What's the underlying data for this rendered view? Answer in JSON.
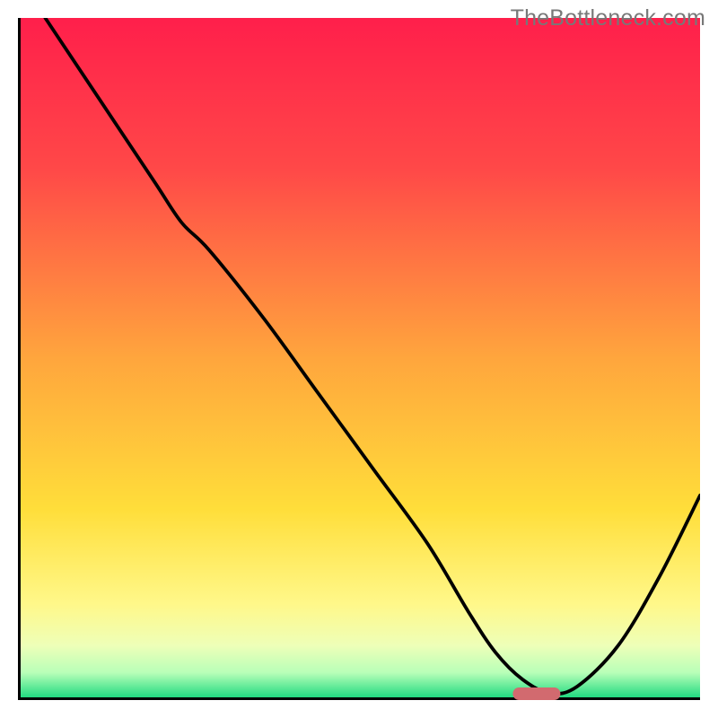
{
  "watermark": "TheBottleneck.com",
  "chart_data": {
    "type": "line",
    "title": "",
    "xlabel": "",
    "ylabel": "",
    "xlim": [
      0,
      100
    ],
    "ylim": [
      0,
      100
    ],
    "x": [
      4,
      12,
      20,
      24,
      28,
      36,
      44,
      52,
      60,
      66,
      70,
      74,
      78,
      82,
      88,
      94,
      100
    ],
    "values": [
      100,
      88,
      76,
      70,
      66,
      56,
      45,
      34,
      23,
      13,
      7,
      3,
      1,
      2,
      8,
      18,
      30
    ],
    "marker": {
      "x": 76,
      "width": 7
    },
    "gradient_stops": [
      {
        "offset": 0,
        "color": "#ff1f4b"
      },
      {
        "offset": 22,
        "color": "#ff4848"
      },
      {
        "offset": 50,
        "color": "#ffa63d"
      },
      {
        "offset": 72,
        "color": "#ffde3a"
      },
      {
        "offset": 86,
        "color": "#fff88a"
      },
      {
        "offset": 92,
        "color": "#eeffb8"
      },
      {
        "offset": 96,
        "color": "#b8ffb8"
      },
      {
        "offset": 100,
        "color": "#11d67b"
      }
    ]
  }
}
